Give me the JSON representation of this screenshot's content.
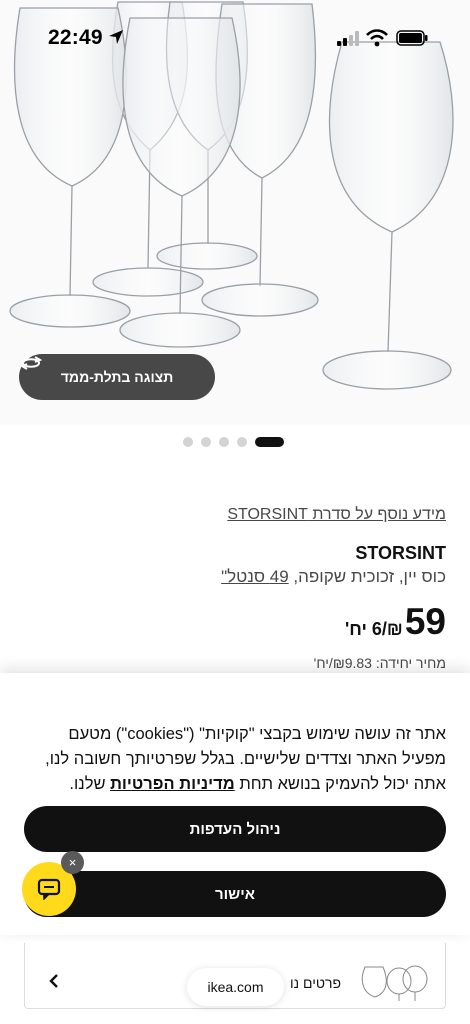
{
  "status_bar": {
    "time": "22:49"
  },
  "hero": {
    "view_3d_label": "תצוגה בתלת-ממד",
    "carousel_dots": 5,
    "active_dot_index": 4
  },
  "product": {
    "series_link": "מידע נוסף על סדרת STORSINT",
    "name": "STORSINT",
    "description": "כוס יין, זכוכית שקופה, ",
    "size_link": "49 סנטל\"",
    "price": "59",
    "price_unit": "₪/6 יח'",
    "unit_price": "מחיר יחידה: ₪9.83/יח'"
  },
  "cookie_banner": {
    "text_before_link": "אתר זה עושה שימוש בקבצי \"קוקיות\" (\"cookies\") מטעם מפעיל האתר וצדדים שלישיים. בגלל שפרטיותך חשובה לנו, אתה יכול להעמיק בנושא תחת ",
    "privacy_link": "מדיניות הפרטיות",
    "text_after_link": " שלנו.",
    "manage_button": "ניהול העדפות",
    "accept_button": "אישור"
  },
  "chat": {
    "close_glyph": "×"
  },
  "bottom": {
    "related_label": "פרטים נו",
    "url": "ikea.com"
  },
  "colors": {
    "accent_yellow": "#ffda1a",
    "button_dark": "#111111",
    "pill_gray": "#484848"
  }
}
